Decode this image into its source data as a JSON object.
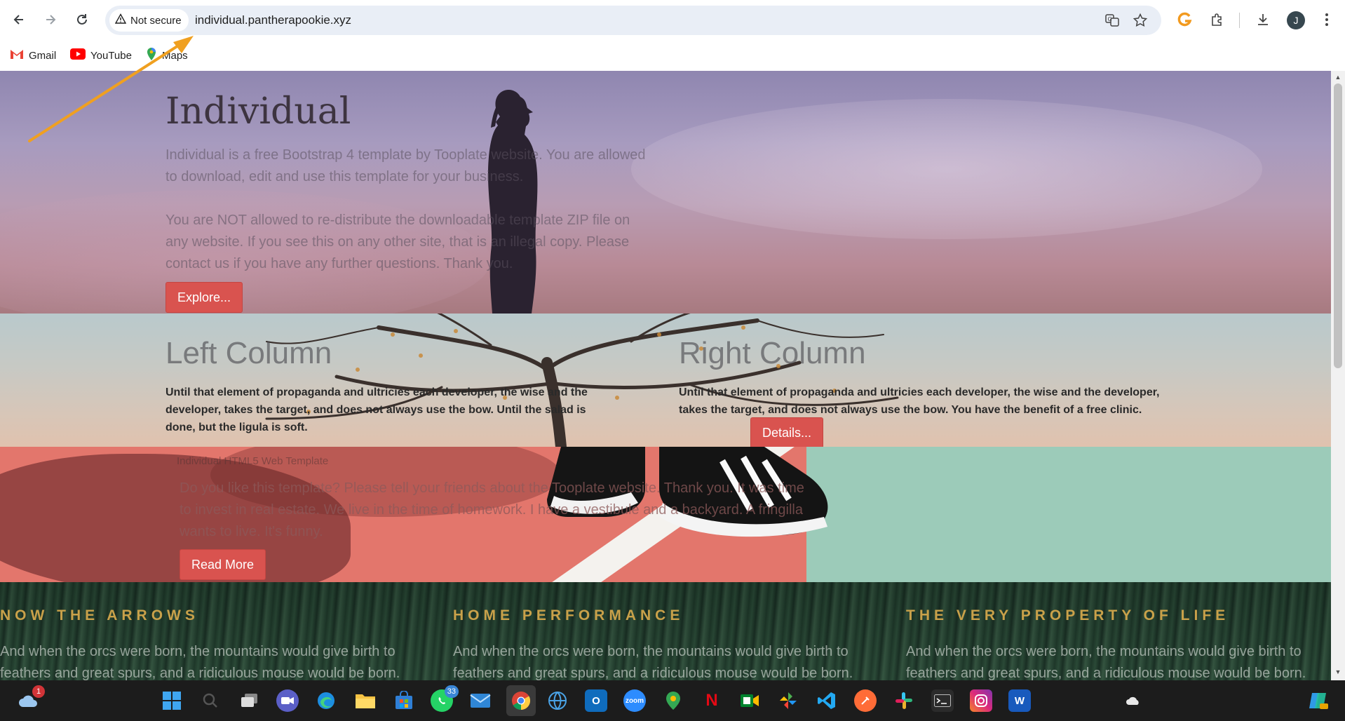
{
  "browser": {
    "security_label": "Not secure",
    "url": "individual.pantherapookie.xyz",
    "avatar_initial": "J",
    "bookmarks": [
      {
        "label": "Gmail",
        "icon": "gmail-icon"
      },
      {
        "label": "YouTube",
        "icon": "youtube-icon"
      },
      {
        "label": "Maps",
        "icon": "maps-icon"
      }
    ]
  },
  "hero": {
    "title": "Individual",
    "paragraph1": "Individual is a free Bootstrap 4 template by Tooplate website. You are allowed to download, edit and use this template for your business.",
    "paragraph2": "You are NOT allowed to re-distribute the downloadable template ZIP file on any website. If you see this on any other site, that is an illegal copy. Please contact us if you have any further questions. Thank you.",
    "button": "Explore..."
  },
  "columns": {
    "left_title": "Left Column",
    "left_text": "Until that element of propaganda and ultricies each developer, the wise and the developer, takes the target, and does not always use the bow. Until the salad is done, but the ligula is soft.",
    "right_title": "Right Column",
    "right_text": "Until that element of propaganda and ultricies each developer, the wise and the developer, takes the target, and does not always use the bow. You have the benefit of a free clinic.",
    "button": "Details..."
  },
  "promo": {
    "kicker": "Individual HTML5 Web Template",
    "text": "Do you like this template? Please tell your friends about the Tooplate website. Thank you. It was time to invest in real estate. We live in the time of homework. I have a vestibule and a backyard. A fringilla wants to live. It's funny.",
    "button": "Read More"
  },
  "features": [
    {
      "title": "NOW THE ARROWS",
      "text": "And when the orcs were born, the mountains would give birth to feathers and great spurs, and a ridiculous mouse would be born."
    },
    {
      "title": "HOME PERFORMANCE",
      "text": "And when the orcs were born, the mountains would give birth to feathers and great spurs, and a ridiculous mouse would be born."
    },
    {
      "title": "THE VERY PROPERTY OF LIFE",
      "text": "And when the orcs were born, the mountains would give birth to feathers and great spurs, and a ridiculous mouse would be born."
    }
  ],
  "taskbar": {
    "weather_badge": "1",
    "whatsapp_badge": "33",
    "zoom_label": "zoom"
  },
  "colors": {
    "accent_red": "#d9534f",
    "feature_gold": "#c9a14a",
    "annotation_arrow": "#f0a020"
  }
}
